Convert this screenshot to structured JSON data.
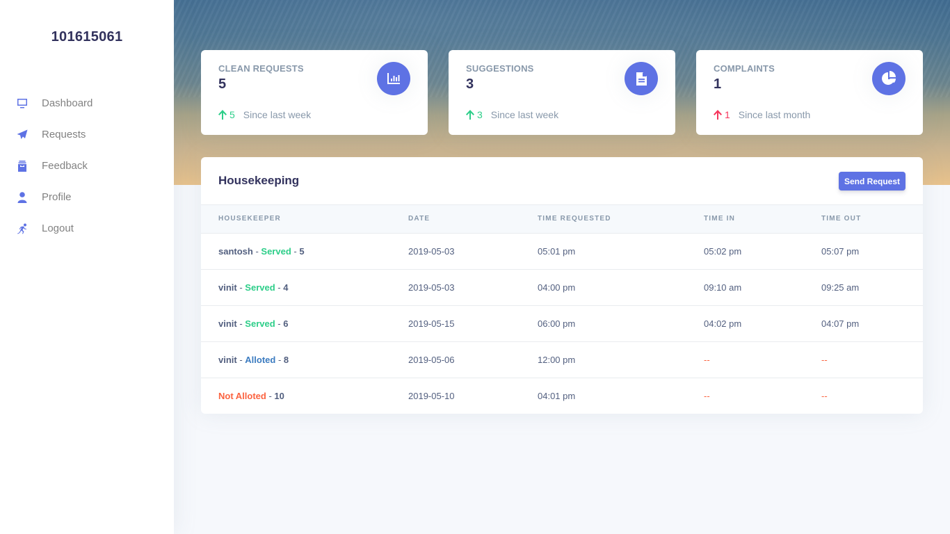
{
  "sidebar": {
    "brand": "101615061",
    "items": [
      {
        "label": "Dashboard",
        "icon": "monitor-icon"
      },
      {
        "label": "Requests",
        "icon": "paper-plane-icon"
      },
      {
        "label": "Feedback",
        "icon": "archive-box-icon"
      },
      {
        "label": "Profile",
        "icon": "user-icon"
      },
      {
        "label": "Logout",
        "icon": "running-person-icon"
      }
    ]
  },
  "stats": [
    {
      "title": "CLEAN REQUESTS",
      "value": "5",
      "delta": "5",
      "since": "Since last week",
      "trend": "up",
      "trend_color": "#2dce89",
      "icon": "bar-chart-icon"
    },
    {
      "title": "SUGGESTIONS",
      "value": "3",
      "delta": "3",
      "since": "Since last week",
      "trend": "up",
      "trend_color": "#2dce89",
      "icon": "document-icon"
    },
    {
      "title": "COMPLAINTS",
      "value": "1",
      "delta": "1",
      "since": "Since last month",
      "trend": "up",
      "trend_color": "#f5365c",
      "icon": "pie-chart-icon"
    }
  ],
  "housekeeping": {
    "title": "Housekeeping",
    "send_button": "Send Request",
    "columns": [
      "HOUSEKEEPER",
      "DATE",
      "TIME REQUESTED",
      "TIME IN",
      "TIME OUT"
    ],
    "separator": " - ",
    "rows": [
      {
        "name": "santosh",
        "status": "Served",
        "status_type": "served",
        "number": "5",
        "date": "2019-05-03",
        "time_requested": "05:01 pm",
        "time_in": "05:02 pm",
        "time_out": "05:07 pm"
      },
      {
        "name": "vinit",
        "status": "Served",
        "status_type": "served",
        "number": "4",
        "date": "2019-05-03",
        "time_requested": "04:00 pm",
        "time_in": "09:10 am",
        "time_out": "09:25 am"
      },
      {
        "name": "vinit",
        "status": "Served",
        "status_type": "served",
        "number": "6",
        "date": "2019-05-15",
        "time_requested": "06:00 pm",
        "time_in": "04:02 pm",
        "time_out": "04:07 pm"
      },
      {
        "name": "vinit",
        "status": "Alloted",
        "status_type": "alloted",
        "number": "8",
        "date": "2019-05-06",
        "time_requested": "12:00 pm",
        "time_in": "--",
        "time_out": "--"
      },
      {
        "name": "",
        "status": "Not Alloted",
        "status_type": "notalloted",
        "number": "10",
        "date": "2019-05-10",
        "time_requested": "04:01 pm",
        "time_in": "--",
        "time_out": "--"
      }
    ]
  },
  "colors": {
    "accent": "#5e72e4",
    "success": "#2dce89",
    "danger": "#f5365c",
    "warning": "#fb6340",
    "alloted": "#3b7bc0",
    "heading": "#32325d",
    "muted": "#8898aa"
  }
}
